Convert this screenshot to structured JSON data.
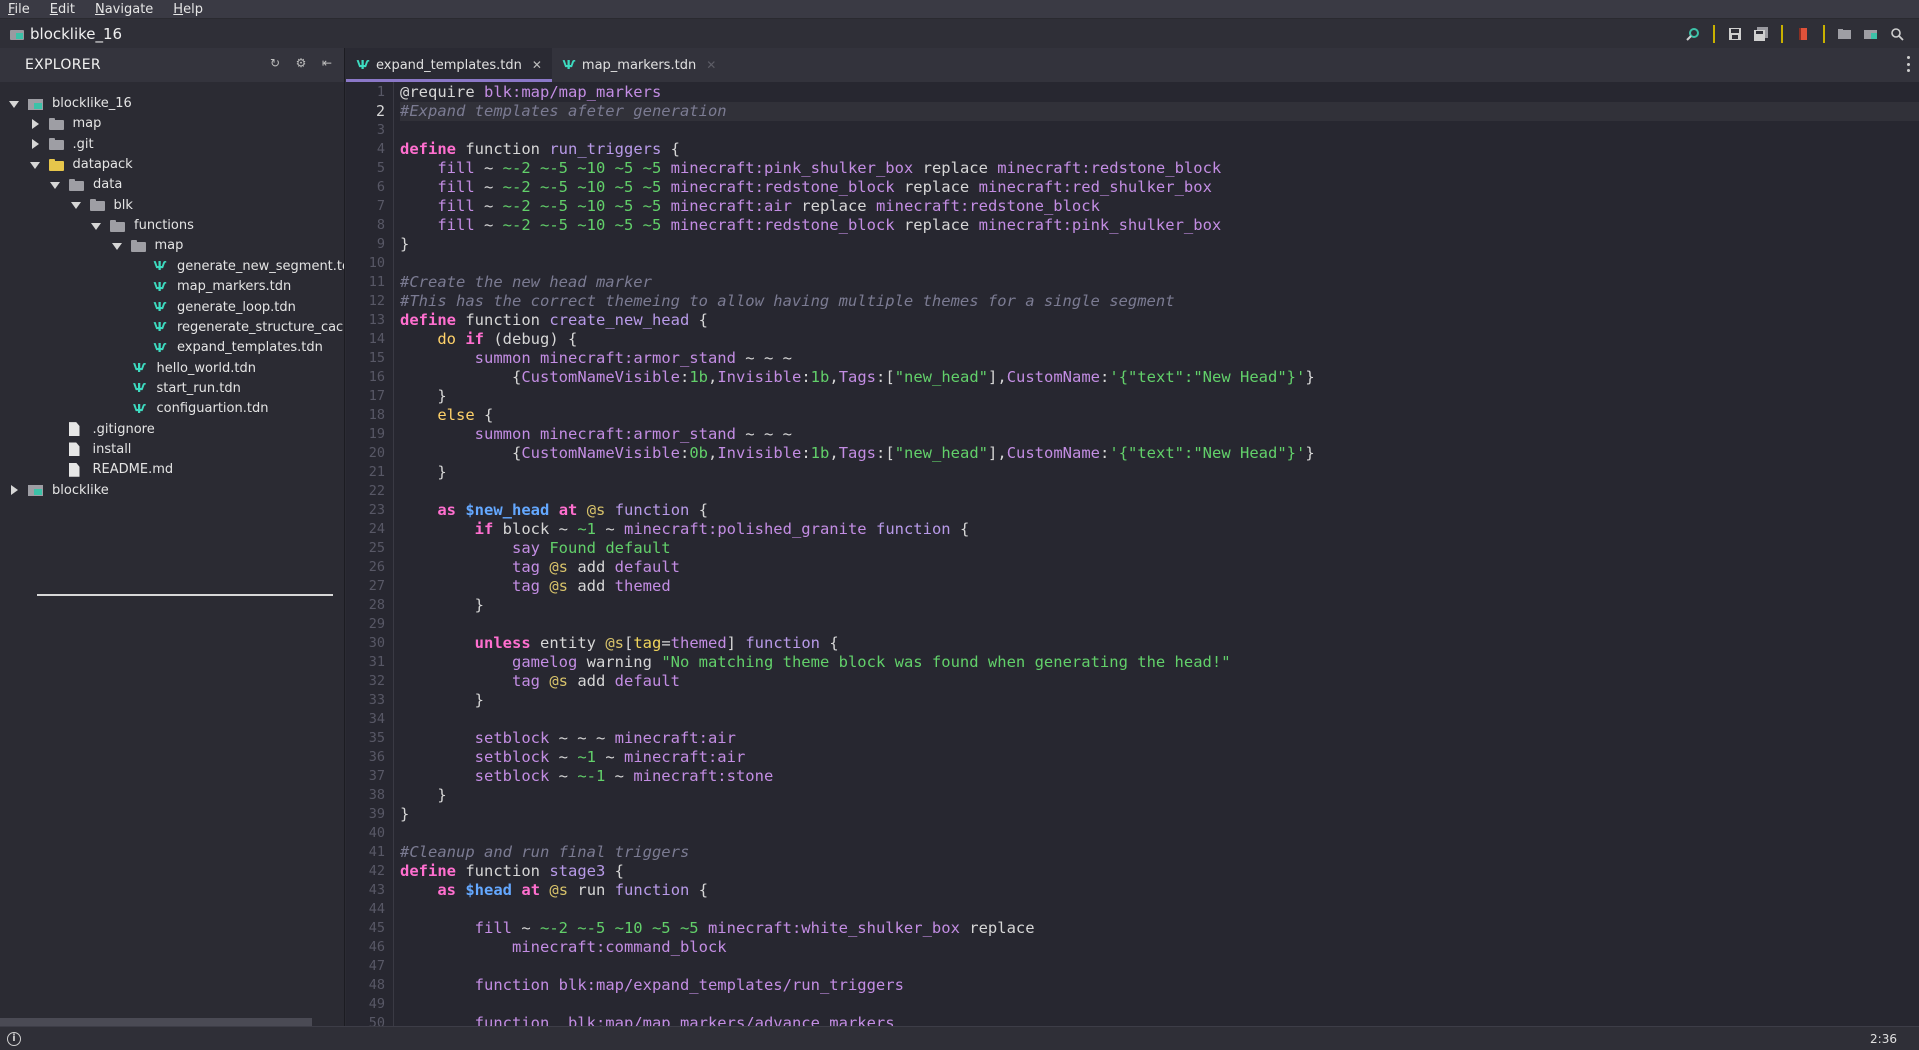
{
  "menu": [
    "File",
    "Edit",
    "Navigate",
    "Help"
  ],
  "project": {
    "title": "blocklike_16"
  },
  "toolbar": {
    "icons": [
      "search-project-icon",
      "save-icon",
      "save-all-icon",
      "book-icon",
      "new-folder-icon",
      "open-folder-icon",
      "search-icon"
    ],
    "sep_color": "#c9b100"
  },
  "explorer": {
    "title": "EXPLORER",
    "tree": [
      {
        "label": "blocklike_16",
        "kind": "project",
        "expanded": true,
        "depth": 0
      },
      {
        "label": "map",
        "kind": "folder",
        "expanded": false,
        "depth": 1
      },
      {
        "label": ".git",
        "kind": "folder",
        "expanded": false,
        "depth": 1
      },
      {
        "label": "datapack",
        "kind": "folder-open",
        "expanded": true,
        "depth": 1
      },
      {
        "label": "data",
        "kind": "folder",
        "expanded": true,
        "depth": 2
      },
      {
        "label": "blk",
        "kind": "folder",
        "expanded": true,
        "depth": 3
      },
      {
        "label": "functions",
        "kind": "folder",
        "expanded": true,
        "depth": 4
      },
      {
        "label": "map",
        "kind": "folder",
        "expanded": true,
        "depth": 5
      },
      {
        "label": "generate_new_segment.tdn",
        "kind": "tdn",
        "depth": 6
      },
      {
        "label": "map_markers.tdn",
        "kind": "tdn",
        "depth": 6
      },
      {
        "label": "generate_loop.tdn",
        "kind": "tdn",
        "depth": 6
      },
      {
        "label": "regenerate_structure_cache.tdn",
        "kind": "tdn",
        "depth": 6
      },
      {
        "label": "expand_templates.tdn",
        "kind": "tdn",
        "depth": 6
      },
      {
        "label": "hello_world.tdn",
        "kind": "tdn",
        "depth": 5
      },
      {
        "label": "start_run.tdn",
        "kind": "tdn",
        "depth": 5
      },
      {
        "label": "configuartion.tdn",
        "kind": "tdn",
        "depth": 5
      },
      {
        "label": ".gitignore",
        "kind": "file",
        "depth": 1
      },
      {
        "label": "install",
        "kind": "file",
        "depth": 1
      },
      {
        "label": "README.md",
        "kind": "file",
        "depth": 1
      },
      {
        "label": "blocklike",
        "kind": "project",
        "expanded": false,
        "depth": 0
      }
    ]
  },
  "tabs": [
    {
      "label": "expand_templates.tdn",
      "active": true
    },
    {
      "label": "map_markers.tdn",
      "active": false
    }
  ],
  "editor": {
    "current_line": 2,
    "lines": [
      [
        [
          "plain",
          "@require "
        ],
        [
          "res",
          "blk:map/map_markers"
        ]
      ],
      [
        [
          "cmt",
          "#Expand templates afeter generation"
        ]
      ],
      [],
      [
        [
          "kw",
          "define"
        ],
        [
          "plain",
          " function "
        ],
        [
          "fn",
          "run_triggers"
        ],
        [
          "plain",
          " {"
        ]
      ],
      [
        [
          "plain",
          "    "
        ],
        [
          "res",
          "fill"
        ],
        [
          "plain",
          " ~ "
        ],
        [
          "num",
          "~-2 ~-5 ~10 ~5 ~5"
        ],
        [
          "plain",
          " "
        ],
        [
          "res",
          "minecraft:pink_shulker_box"
        ],
        [
          "plain",
          " replace "
        ],
        [
          "res",
          "minecraft:redstone_block"
        ]
      ],
      [
        [
          "plain",
          "    "
        ],
        [
          "res",
          "fill"
        ],
        [
          "plain",
          " ~ "
        ],
        [
          "num",
          "~-2 ~-5 ~10 ~5 ~5"
        ],
        [
          "plain",
          " "
        ],
        [
          "res",
          "minecraft:redstone_block"
        ],
        [
          "plain",
          " replace "
        ],
        [
          "res",
          "minecraft:red_shulker_box"
        ]
      ],
      [
        [
          "plain",
          "    "
        ],
        [
          "res",
          "fill"
        ],
        [
          "plain",
          " ~ "
        ],
        [
          "num",
          "~-2 ~-5 ~10 ~5 ~5"
        ],
        [
          "plain",
          " "
        ],
        [
          "res",
          "minecraft:air"
        ],
        [
          "plain",
          " replace "
        ],
        [
          "res",
          "minecraft:redstone_block"
        ]
      ],
      [
        [
          "plain",
          "    "
        ],
        [
          "res",
          "fill"
        ],
        [
          "plain",
          " ~ "
        ],
        [
          "num",
          "~-2 ~-5 ~10 ~5 ~5"
        ],
        [
          "plain",
          " "
        ],
        [
          "res",
          "minecraft:redstone_block"
        ],
        [
          "plain",
          " replace "
        ],
        [
          "res",
          "minecraft:pink_shulker_box"
        ]
      ],
      [
        [
          "plain",
          "}"
        ]
      ],
      [],
      [
        [
          "cmt",
          "#Create the new head marker"
        ]
      ],
      [
        [
          "cmt",
          "#This has the correct themeing to allow having multiple themes for a single segment"
        ]
      ],
      [
        [
          "kw",
          "define"
        ],
        [
          "plain",
          " function "
        ],
        [
          "fn",
          "create_new_head"
        ],
        [
          "plain",
          " {"
        ]
      ],
      [
        [
          "plain",
          "    "
        ],
        [
          "cond",
          "do"
        ],
        [
          "plain",
          " "
        ],
        [
          "kw",
          "if"
        ],
        [
          "plain",
          " (debug) {"
        ]
      ],
      [
        [
          "plain",
          "        "
        ],
        [
          "res",
          "summon"
        ],
        [
          "plain",
          " "
        ],
        [
          "res",
          "minecraft:armor_stand"
        ],
        [
          "plain",
          " ~ ~ ~"
        ]
      ],
      [
        [
          "plain",
          "            {"
        ],
        [
          "res",
          "CustomNameVisible"
        ],
        [
          "plain",
          ":"
        ],
        [
          "num",
          "1b"
        ],
        [
          "plain",
          ","
        ],
        [
          "res",
          "Invisible"
        ],
        [
          "plain",
          ":"
        ],
        [
          "num",
          "1b"
        ],
        [
          "plain",
          ","
        ],
        [
          "res",
          "Tags"
        ],
        [
          "plain",
          ":["
        ],
        [
          "str",
          "\"new_head\""
        ],
        [
          "plain",
          "],"
        ],
        [
          "res",
          "CustomName"
        ],
        [
          "plain",
          ":"
        ],
        [
          "str",
          "'{\"text\":\"New Head\"}'"
        ],
        [
          "plain",
          "}"
        ]
      ],
      [
        [
          "plain",
          "    }"
        ]
      ],
      [
        [
          "plain",
          "    "
        ],
        [
          "cond",
          "else"
        ],
        [
          "plain",
          " {"
        ]
      ],
      [
        [
          "plain",
          "        "
        ],
        [
          "res",
          "summon"
        ],
        [
          "plain",
          " "
        ],
        [
          "res",
          "minecraft:armor_stand"
        ],
        [
          "plain",
          " ~ ~ ~"
        ]
      ],
      [
        [
          "plain",
          "            {"
        ],
        [
          "res",
          "CustomNameVisible"
        ],
        [
          "plain",
          ":"
        ],
        [
          "num",
          "0b"
        ],
        [
          "plain",
          ","
        ],
        [
          "res",
          "Invisible"
        ],
        [
          "plain",
          ":"
        ],
        [
          "num",
          "1b"
        ],
        [
          "plain",
          ","
        ],
        [
          "res",
          "Tags"
        ],
        [
          "plain",
          ":["
        ],
        [
          "str",
          "\"new_head\""
        ],
        [
          "plain",
          "],"
        ],
        [
          "res",
          "CustomName"
        ],
        [
          "plain",
          ":"
        ],
        [
          "str",
          "'{\"text\":\"New Head\"}'"
        ],
        [
          "plain",
          "}"
        ]
      ],
      [
        [
          "plain",
          "    }"
        ]
      ],
      [],
      [
        [
          "plain",
          "    "
        ],
        [
          "kw",
          "as"
        ],
        [
          "plain",
          " "
        ],
        [
          "var",
          "$new_head"
        ],
        [
          "plain",
          " "
        ],
        [
          "kw",
          "at"
        ],
        [
          "plain",
          " "
        ],
        [
          "sel",
          "@s"
        ],
        [
          "plain",
          " "
        ],
        [
          "fn",
          "function"
        ],
        [
          "plain",
          " {"
        ]
      ],
      [
        [
          "plain",
          "        "
        ],
        [
          "kw",
          "if"
        ],
        [
          "plain",
          " block ~ "
        ],
        [
          "num",
          "~1"
        ],
        [
          "plain",
          " ~ "
        ],
        [
          "res",
          "minecraft:polished_granite"
        ],
        [
          "plain",
          " "
        ],
        [
          "fn",
          "function"
        ],
        [
          "plain",
          " {"
        ]
      ],
      [
        [
          "plain",
          "            "
        ],
        [
          "res",
          "say"
        ],
        [
          "plain",
          " "
        ],
        [
          "str",
          "Found default"
        ]
      ],
      [
        [
          "plain",
          "            "
        ],
        [
          "res",
          "tag"
        ],
        [
          "plain",
          " "
        ],
        [
          "sel",
          "@s"
        ],
        [
          "plain",
          " add "
        ],
        [
          "res",
          "default"
        ]
      ],
      [
        [
          "plain",
          "            "
        ],
        [
          "res",
          "tag"
        ],
        [
          "plain",
          " "
        ],
        [
          "sel",
          "@s"
        ],
        [
          "plain",
          " add "
        ],
        [
          "res",
          "themed"
        ]
      ],
      [
        [
          "plain",
          "        }"
        ]
      ],
      [],
      [
        [
          "plain",
          "        "
        ],
        [
          "kw",
          "unless"
        ],
        [
          "plain",
          " entity "
        ],
        [
          "sel",
          "@s"
        ],
        [
          "plain",
          "["
        ],
        [
          "tagk",
          "tag"
        ],
        [
          "plain",
          "="
        ],
        [
          "res",
          "themed"
        ],
        [
          "plain",
          "] "
        ],
        [
          "fn",
          "function"
        ],
        [
          "plain",
          " {"
        ]
      ],
      [
        [
          "plain",
          "            "
        ],
        [
          "res",
          "gamelog"
        ],
        [
          "plain",
          " warning "
        ],
        [
          "str",
          "\"No matching theme block was found when generating the head!\""
        ]
      ],
      [
        [
          "plain",
          "            "
        ],
        [
          "res",
          "tag"
        ],
        [
          "plain",
          " "
        ],
        [
          "sel",
          "@s"
        ],
        [
          "plain",
          " add "
        ],
        [
          "res",
          "default"
        ]
      ],
      [
        [
          "plain",
          "        }"
        ]
      ],
      [],
      [
        [
          "plain",
          "        "
        ],
        [
          "res",
          "setblock"
        ],
        [
          "plain",
          " ~ ~ ~ "
        ],
        [
          "res",
          "minecraft:air"
        ]
      ],
      [
        [
          "plain",
          "        "
        ],
        [
          "res",
          "setblock"
        ],
        [
          "plain",
          " ~ "
        ],
        [
          "num",
          "~1"
        ],
        [
          "plain",
          " ~ "
        ],
        [
          "res",
          "minecraft:air"
        ]
      ],
      [
        [
          "plain",
          "        "
        ],
        [
          "res",
          "setblock"
        ],
        [
          "plain",
          " ~ "
        ],
        [
          "num",
          "~-1"
        ],
        [
          "plain",
          " ~ "
        ],
        [
          "res",
          "minecraft:stone"
        ]
      ],
      [
        [
          "plain",
          "    }"
        ]
      ],
      [
        [
          "plain",
          "}"
        ]
      ],
      [],
      [
        [
          "cmt",
          "#Cleanup and run final triggers"
        ]
      ],
      [
        [
          "kw",
          "define"
        ],
        [
          "plain",
          " function "
        ],
        [
          "fn",
          "stage3"
        ],
        [
          "plain",
          " {"
        ]
      ],
      [
        [
          "plain",
          "    "
        ],
        [
          "kw",
          "as"
        ],
        [
          "plain",
          " "
        ],
        [
          "var",
          "$head"
        ],
        [
          "plain",
          " "
        ],
        [
          "kw",
          "at"
        ],
        [
          "plain",
          " "
        ],
        [
          "sel",
          "@s"
        ],
        [
          "plain",
          " run "
        ],
        [
          "fn",
          "function"
        ],
        [
          "plain",
          " {"
        ]
      ],
      [],
      [
        [
          "plain",
          "        "
        ],
        [
          "res",
          "fill"
        ],
        [
          "plain",
          " ~ "
        ],
        [
          "num",
          "~-2 ~-5 ~10 ~5 ~5"
        ],
        [
          "plain",
          " "
        ],
        [
          "res",
          "minecraft:white_shulker_box"
        ],
        [
          "plain",
          " replace"
        ]
      ],
      [
        [
          "plain",
          "            "
        ],
        [
          "res",
          "minecraft:command_block"
        ]
      ],
      [],
      [
        [
          "plain",
          "        "
        ],
        [
          "res",
          "function"
        ],
        [
          "plain",
          " "
        ],
        [
          "res",
          "blk:map/expand_templates/run_triggers"
        ]
      ],
      [],
      [
        [
          "plain",
          "        "
        ],
        [
          "res",
          "function"
        ],
        [
          "plain",
          "  "
        ],
        [
          "res",
          "blk:map/map_markers/advance_markers"
        ]
      ]
    ]
  },
  "status": {
    "cursor": "2:36"
  }
}
